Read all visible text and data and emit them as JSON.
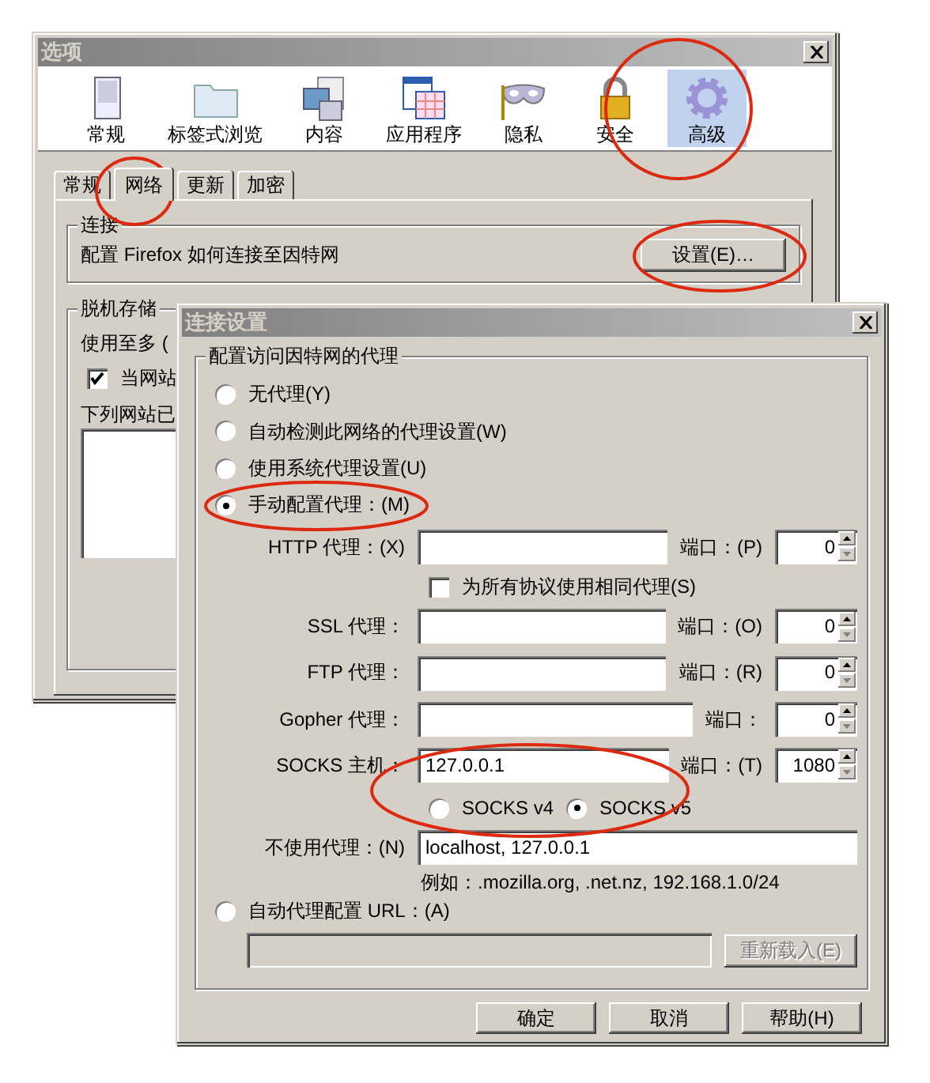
{
  "options_window": {
    "title": "选项",
    "toolbar": [
      {
        "label": "常规",
        "kind": "general",
        "selected": false
      },
      {
        "label": "标签式浏览",
        "kind": "tabs",
        "selected": false
      },
      {
        "label": "内容",
        "kind": "content",
        "selected": false
      },
      {
        "label": "应用程序",
        "kind": "applications",
        "selected": false
      },
      {
        "label": "隐私",
        "kind": "privacy",
        "selected": false
      },
      {
        "label": "安全",
        "kind": "security",
        "selected": false
      },
      {
        "label": "高级",
        "kind": "advanced",
        "selected": true
      }
    ],
    "tabs": [
      {
        "label": "常规",
        "selected": false
      },
      {
        "label": "网络",
        "selected": true
      },
      {
        "label": "更新",
        "selected": false
      },
      {
        "label": "加密",
        "selected": false
      }
    ],
    "connection_group": {
      "legend": "连接",
      "description": "配置 Firefox 如何连接至因特网",
      "button": "设置(E)…"
    },
    "offline_group": {
      "legend": "脱机存储",
      "usage": "使用至多 (",
      "checkbox": {
        "label": "当网站",
        "checked": true
      },
      "list_label": "下列网站已"
    }
  },
  "connection_dialog": {
    "title": "连接设置",
    "legend": "配置访问因特网的代理",
    "modes": [
      {
        "label": "无代理(Y)",
        "selected": false
      },
      {
        "label": "自动检测此网络的代理设置(W)",
        "selected": false
      },
      {
        "label": "使用系统代理设置(U)",
        "selected": false
      },
      {
        "label": "手动配置代理：(M)",
        "selected": true
      }
    ],
    "proxies": [
      {
        "label": "HTTP 代理：(X)",
        "port_label": "端口：(P)",
        "port": "0"
      },
      {
        "label": "SSL 代理：",
        "port_label": "端口：(O)",
        "port": "0"
      },
      {
        "label": "FTP 代理：",
        "port_label": "端口：(R)",
        "port": "0"
      },
      {
        "label": "Gopher 代理：",
        "port_label": "端口：",
        "port": "0"
      },
      {
        "label": "SOCKS 主机：",
        "value": "127.0.0.1",
        "port_label": "端口：(T)",
        "port": "1080"
      }
    ],
    "same_proxy": {
      "label": "为所有协议使用相同代理(S)",
      "checked": false
    },
    "socks_versions": [
      {
        "label": "SOCKS v4",
        "selected": false
      },
      {
        "label": "SOCKS v5",
        "selected": true
      }
    ],
    "no_proxy": {
      "label": "不使用代理：(N)",
      "value": "localhost, 127.0.0.1"
    },
    "example": "例如：.mozilla.org, .net.nz, 192.168.1.0/24",
    "auto_url": {
      "label": "自动代理配置 URL：(A)",
      "selected": false,
      "button": "重新载入(E)",
      "button_disabled": true
    },
    "buttons": [
      "确定",
      "取消",
      "帮助(H)"
    ]
  }
}
